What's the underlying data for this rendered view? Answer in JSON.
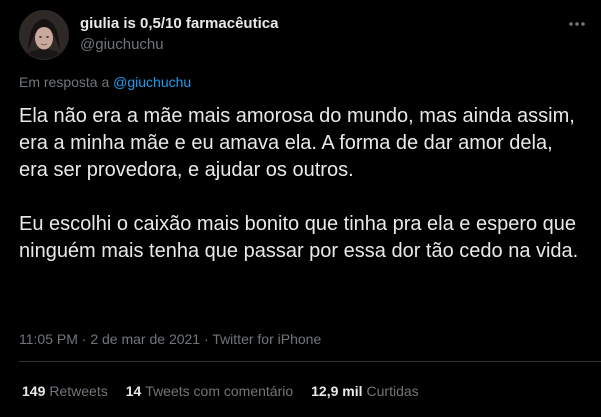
{
  "author": {
    "display_name": "giulia is 0,5/10 farmacêutica",
    "handle": "@giuchuchu"
  },
  "icons": {
    "more": "more-horizontal-icon",
    "avatar": "profile-photo"
  },
  "reply": {
    "prefix": "Em resposta a ",
    "mention": "@giuchuchu"
  },
  "tweet": {
    "paragraphs": [
      "Ela não era a mãe mais amorosa do mundo, mas ainda assim, era a minha mãe e eu amava ela. A forma de dar amor dela, era ser provedora, e ajudar os outros.",
      "Eu escolhi o caixão mais bonito que tinha pra ela e espero que ninguém mais tenha que passar por essa dor tão cedo na vida."
    ]
  },
  "meta": {
    "time": "11:05 PM",
    "separator": " · ",
    "date": "2 de mar de 2021",
    "source": "Twitter for iPhone"
  },
  "stats": {
    "retweets_count": "149",
    "retweets_label": "Retweets",
    "quotes_count": "14",
    "quotes_label": "Tweets com comentário",
    "likes_count": "12,9 mil",
    "likes_label": "Curtidas"
  },
  "colors": {
    "background": "#000000",
    "text_primary": "#e7e9ea",
    "text_secondary": "#71767b",
    "link": "#1d9bf0",
    "divider": "#2f3336"
  }
}
